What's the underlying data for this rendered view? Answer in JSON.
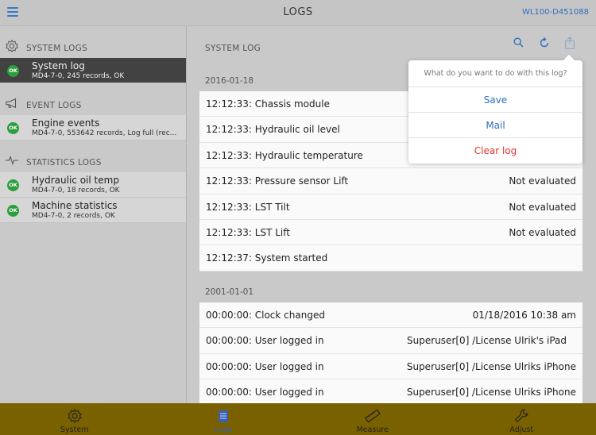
{
  "header": {
    "title": "LOGS",
    "device_id": "WL100-D451088"
  },
  "sidebar": {
    "groups": [
      {
        "label": "SYSTEM LOGS",
        "icon": "gear-icon",
        "items": [
          {
            "name": "System log",
            "meta": "MD4-7-0, 245 records, OK",
            "badge": "OK"
          }
        ]
      },
      {
        "label": "EVENT LOGS",
        "icon": "megaphone-icon",
        "items": [
          {
            "name": "Engine events",
            "meta": "MD4-7-0, 553642 records, Log full (rec...",
            "badge": "OK"
          }
        ]
      },
      {
        "label": "STATISTICS LOGS",
        "icon": "pulse-icon",
        "items": [
          {
            "name": "Hydraulic oil temp",
            "meta": "MD4-7-0, 18 records, OK",
            "badge": "OK"
          },
          {
            "name": "Machine statistics",
            "meta": "MD4-7-0, 2 records, OK",
            "badge": "OK"
          }
        ]
      }
    ]
  },
  "main": {
    "title": "SYSTEM LOG",
    "sections": [
      {
        "date": "2016-01-18",
        "entries": [
          {
            "text": "12:12:33: Chassis module",
            "value": ""
          },
          {
            "text": "12:12:33: Hydraulic oil level",
            "value": ""
          },
          {
            "text": "12:12:33: Hydraulic temperature",
            "value": ""
          },
          {
            "text": "12:12:33: Pressure sensor Lift",
            "value": "Not evaluated"
          },
          {
            "text": "12:12:33: LST Tilt",
            "value": "Not evaluated"
          },
          {
            "text": "12:12:33: LST Lift",
            "value": "Not evaluated"
          },
          {
            "text": "12:12:37: System started",
            "value": ""
          }
        ]
      },
      {
        "date": "2001-01-01",
        "entries": [
          {
            "text": "00:00:00: Clock changed",
            "value": "01/18/2016 10:38 am"
          },
          {
            "text": "00:00:00: User logged in",
            "value": "Superuser[0] /License Ulrik's iPad"
          },
          {
            "text": "00:00:00: User logged in",
            "value": "Superuser[0] /License Ulriks iPhone"
          },
          {
            "text": "00:00:00: User logged in",
            "value": "Superuser[0] /License Ulriks iPhone"
          }
        ]
      }
    ]
  },
  "popover": {
    "question": "What do you want to do with this log?",
    "save": "Save",
    "mail": "Mail",
    "clear": "Clear log"
  },
  "tabs": [
    {
      "label": "System",
      "icon": "gear-icon"
    },
    {
      "label": "Logs",
      "icon": "notepad-icon"
    },
    {
      "label": "Measure",
      "icon": "ruler-icon"
    },
    {
      "label": "Adjust",
      "icon": "wrench-icon"
    }
  ],
  "colors": {
    "accent": "#2f6fbf",
    "danger": "#e0332b",
    "ok": "#2d9e3e",
    "tabbar": "#7a6100"
  }
}
